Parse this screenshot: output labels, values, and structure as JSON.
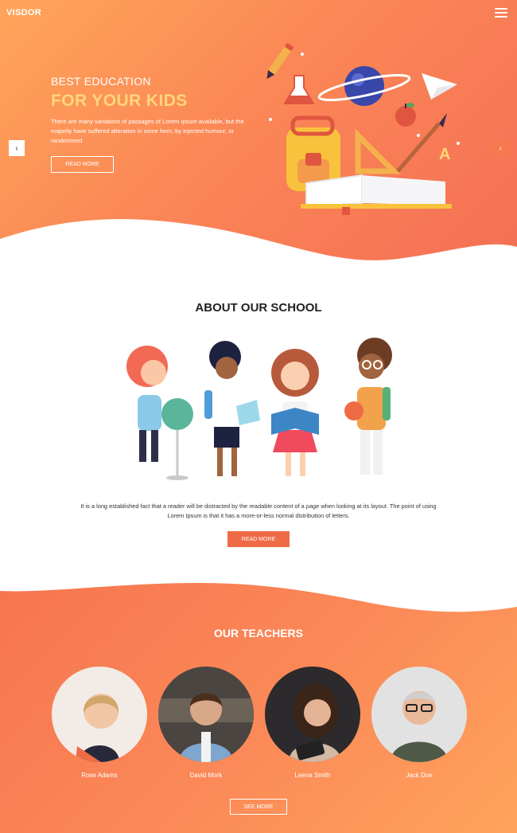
{
  "brand": "VISDOR",
  "hero": {
    "subtitle": "BEST EDUCATION",
    "title": "FOR YOUR KIDS",
    "description": "There are many variations of passages of Lorem Ipsum available, but the majority have suffered alteration in some form, by injected humour, or randomised",
    "button_label": "READ MORE",
    "prev_glyph": "‹",
    "next_glyph": "›"
  },
  "about": {
    "title": "ABOUT OUR SCHOOL",
    "text": "It is a long established fact that a reader will be distracted by the readable content of a page when looking at its layout. The point of using Lorem Ipsum is that it has a more-or-less normal distribution of letters.",
    "button_label": "READ MORE"
  },
  "teachers": {
    "title": "OUR TEACHERS",
    "items": [
      {
        "name": "Rose Adams"
      },
      {
        "name": "David Mork"
      },
      {
        "name": "Leena Smith"
      },
      {
        "name": "Jack Doe"
      }
    ],
    "button_label": "SEE MORE"
  },
  "colors": {
    "accent": "#ef6b45",
    "hero_title": "#ffd77a",
    "hero_gradient_start": "#ffa55a",
    "hero_gradient_end": "#f46f55"
  },
  "icons": [
    "menu-icon",
    "chevron-left-icon",
    "chevron-right-icon"
  ]
}
